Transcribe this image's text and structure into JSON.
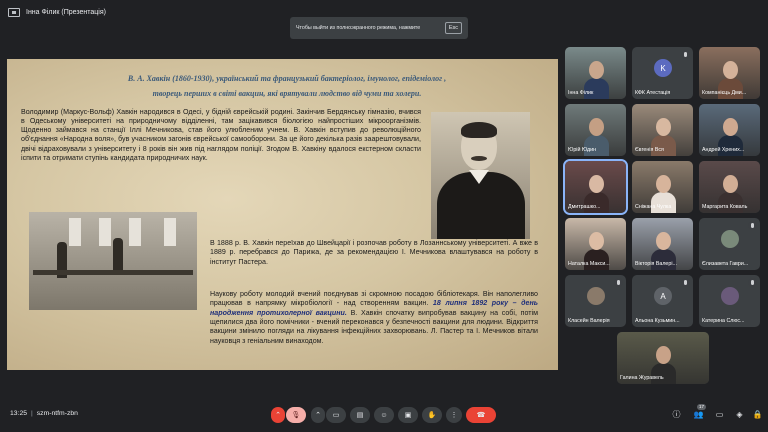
{
  "presenter_label": "Інна Філик (Презентація)",
  "fullscreen_hint": {
    "text": "Чтобы выйти из полноэкранного режима, нажмите",
    "key": "Esc"
  },
  "slide": {
    "title_line1": "В. А. Хавкін (1860-1930), український та французький бактеріолог, імунолог, епідеміолог ,",
    "title_line2": "творець перших в світі вакцин, які врятували людство від чуми та холери.",
    "paragraph1": "Володимир (Маркус-Вольф) Хавкін народився в Одесі, у бідній єврейській родині. Закінчив Бердянську гімназію, вчився в Одеському університеті на природничому відділенні, там зацікавився біологією найпростіших мікроорганізмів. Щоденно займався на станції Іллі Мечникова, став його улюбленим учнем. В. Хавкін вступив до революційного об'єднання «Народна воля», був учасником загонів єврейської самооборони. За це його декілька разів заарештовували, двічі відраховували з університету і 8 років він жив під наглядом поліції. Згодом В. Хавкіну вдалося екстерном скласти іспити та отримати ступінь кандидата природничих наук.",
    "paragraph2": "В 1888 р. В. Хавкін переїхав до Швейцарії і розпочав роботу в Лозаннському університеті. А вже в 1889 р. перебрався до Парижа, де за рекомендацією І. Мечникова влаштувався на роботу в інститут Пастера.",
    "paragraph3_a": "Наукову роботу молодий вчений поєднував зі скромною посадою бібліотекаря. Він наполегливо працював в напрямку мікробіології - над створенням вакцин.",
    "paragraph3_em": "18 липня 1892 року – день народження протихолерної вакцини.",
    "paragraph3_b": "В. Хавкін спочатку випробував вакцину на собі, потім щепилися два його помічники - вчений переконався у безпечності вакцини для людини. Відкриття вакцини змінило погляди на лікування інфекційних захворювань. Л. Пастер та І. Мечников вітали науковця з геніальним винаходом."
  },
  "participants": [
    {
      "name": "Інна Філик",
      "type": "video",
      "skin": "#c9a68c",
      "shirt": "#2b3b5c",
      "bg": "#7a8a8a"
    },
    {
      "name": "КФК Атестація",
      "type": "avatar",
      "letter": "K",
      "color": "#5c6bc0"
    },
    {
      "name": "Компанієць Дми...",
      "type": "video",
      "skin": "#d4b29a",
      "shirt": "#6b4a3a",
      "bg": "#8a6f5e"
    },
    {
      "name": "Юрій Юдин",
      "type": "video",
      "skin": "#c49f84",
      "shirt": "#4a5c6b",
      "bg": "#6f7a7a"
    },
    {
      "name": "Євгенія Вся",
      "type": "video",
      "skin": "#d8b8a0",
      "shirt": "#7a5a4a",
      "bg": "#9a8a7a"
    },
    {
      "name": "Андрей Хрених...",
      "type": "video",
      "skin": "#cfa990",
      "shirt": "#1f2a3a",
      "bg": "#5a6a7a"
    },
    {
      "name": "Дмитрашко...",
      "type": "video",
      "skin": "#d9b9a3",
      "shirt": "#3a2a2a",
      "bg": "#6a4a4a",
      "active": true
    },
    {
      "name": "Сніжана Чулка",
      "type": "video",
      "skin": "#d7b49b",
      "shirt": "#e8e0d8",
      "bg": "#8a7a6a"
    },
    {
      "name": "Маргарита Коваль",
      "type": "video",
      "skin": "#d2ae95",
      "shirt": "#3a3030",
      "bg": "#5a4a4a"
    },
    {
      "name": "Наталка Макси...",
      "type": "video",
      "skin": "#dcbca4",
      "shirt": "#2a2020",
      "bg": "#c8b8a8"
    },
    {
      "name": "Вікторія Валері...",
      "type": "video",
      "skin": "#d9b69d",
      "shirt": "#2c2c3a",
      "bg": "#9aa0aa"
    },
    {
      "name": "Єлизавета Гаври...",
      "type": "avatar",
      "letter": "",
      "color": "#7a8a7a"
    },
    {
      "name": "Класейн Валерія",
      "type": "avatar",
      "letter": "",
      "color": "#8a7a6a"
    },
    {
      "name": "Альона Кузьмин...",
      "type": "avatar",
      "letter": "A",
      "color": "#5f6368"
    },
    {
      "name": "Катерина Слюс...",
      "type": "avatar",
      "letter": "",
      "color": "#6a5a7a"
    },
    {
      "name": "Галина Журавель",
      "type": "video",
      "skin": "#c8a288",
      "shirt": "#2a2a2a",
      "bg": "#5a5a4a"
    }
  ],
  "bottom": {
    "time": "13:25",
    "separator": "|",
    "meeting_code": "szm-ntfm-zbn",
    "participant_count": "17"
  },
  "colors": {
    "background": "#202124",
    "hangup": "#ea4335",
    "muted": "#f6aea9",
    "title": "#3b5a7a",
    "highlight": "#1f2f7a"
  }
}
